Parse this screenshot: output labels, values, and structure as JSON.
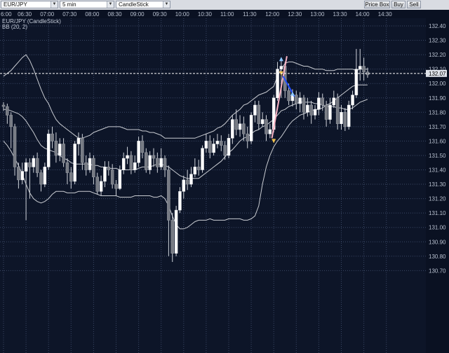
{
  "toolbar": {
    "symbol": "EUR/JPY",
    "timeframe": "5 min",
    "chart_style": "CandleStick",
    "buttons": [
      "Price Box",
      "Buy",
      "Sell"
    ]
  },
  "colors": {
    "background": "#0d1528",
    "grid": "#3a4764",
    "candle_up": "#ffffff",
    "candle_down": "#777b84",
    "wick": "#cfd3da",
    "bands": "#c9ccd2",
    "price_line": "#ffffff",
    "price_label_bg": "#dfe3ea",
    "marker_up": "#8fc8ff",
    "marker_down": "#f2c24d",
    "trend_pink": "#f7b3c4",
    "trend_blue": "#1f4dff"
  },
  "chart_data": {
    "type": "candlestick",
    "legend": [
      "EUR/JPY (CandleStick)",
      "BB (20, 2)"
    ],
    "x_ticks": [
      "6:00",
      "06:30",
      "07:00",
      "07:30",
      "08:00",
      "08:30",
      "09:00",
      "09:30",
      "10:00",
      "10:30",
      "11:00",
      "11:30",
      "12:00",
      "12:30",
      "13:00",
      "13:30",
      "14:00",
      "14:30"
    ],
    "y_ticks": [
      "132.40",
      "132.30",
      "132.20",
      "132.10",
      "132.00",
      "131.90",
      "131.80",
      "131.70",
      "131.60",
      "131.50",
      "131.40",
      "131.30",
      "131.20",
      "131.10",
      "131.00",
      "130.90",
      "130.80",
      "130.70"
    ],
    "ylim": [
      130.65,
      132.45
    ],
    "start_time": "06:00",
    "interval_minutes": 5,
    "current_price": "132.07",
    "candles": [
      [
        131.85,
        131.84,
        131.87,
        131.81
      ],
      [
        131.84,
        131.78,
        131.86,
        131.72
      ],
      [
        131.78,
        131.7,
        131.8,
        131.55
      ],
      [
        131.7,
        131.42,
        131.72,
        131.36
      ],
      [
        131.42,
        131.33,
        131.45,
        131.27
      ],
      [
        131.33,
        131.39,
        131.45,
        131.3
      ],
      [
        131.39,
        131.45,
        131.48,
        131.05
      ],
      [
        131.45,
        131.42,
        131.48,
        131.2
      ],
      [
        131.42,
        131.48,
        131.5,
        131.38
      ],
      [
        131.48,
        131.38,
        131.52,
        131.35
      ],
      [
        131.38,
        131.3,
        131.4,
        131.25
      ],
      [
        131.3,
        131.42,
        131.45,
        131.28
      ],
      [
        131.42,
        131.65,
        131.68,
        131.4
      ],
      [
        131.65,
        131.6,
        131.7,
        131.55
      ],
      [
        131.6,
        131.5,
        131.66,
        131.45
      ],
      [
        131.5,
        131.58,
        131.62,
        131.46
      ],
      [
        131.58,
        131.45,
        131.62,
        131.42
      ],
      [
        131.45,
        131.38,
        131.48,
        131.3
      ],
      [
        131.38,
        131.32,
        131.42,
        131.27
      ],
      [
        131.32,
        131.58,
        131.6,
        131.3
      ],
      [
        131.58,
        131.62,
        131.66,
        131.5
      ],
      [
        131.62,
        131.45,
        131.65,
        131.4
      ],
      [
        131.45,
        131.4,
        131.5,
        131.36
      ],
      [
        131.4,
        131.48,
        131.52,
        131.38
      ],
      [
        131.48,
        131.35,
        131.5,
        131.3
      ],
      [
        131.35,
        131.25,
        131.38,
        131.23
      ],
      [
        131.25,
        131.32,
        131.36,
        131.22
      ],
      [
        131.32,
        131.42,
        131.46,
        131.28
      ],
      [
        131.42,
        131.4,
        131.46,
        131.36
      ],
      [
        131.4,
        131.3,
        131.44,
        131.27
      ],
      [
        131.3,
        131.27,
        131.33,
        131.22
      ],
      [
        131.27,
        131.4,
        131.43,
        131.26
      ],
      [
        131.4,
        131.48,
        131.52,
        131.37
      ],
      [
        131.48,
        131.5,
        131.56,
        131.44
      ],
      [
        131.5,
        131.4,
        131.53,
        131.37
      ],
      [
        131.4,
        131.45,
        131.5,
        131.38
      ],
      [
        131.45,
        131.6,
        131.63,
        131.42
      ],
      [
        131.6,
        131.52,
        131.64,
        131.48
      ],
      [
        131.52,
        131.4,
        131.55,
        131.38
      ],
      [
        131.4,
        131.5,
        131.53,
        131.37
      ],
      [
        131.5,
        131.48,
        131.55,
        131.42
      ],
      [
        131.48,
        131.42,
        131.52,
        131.38
      ],
      [
        131.42,
        131.48,
        131.55,
        131.4
      ],
      [
        131.48,
        131.4,
        131.5,
        131.35
      ],
      [
        131.4,
        131.05,
        131.43,
        130.8
      ],
      [
        131.05,
        130.82,
        131.1,
        130.76
      ],
      [
        130.82,
        131.12,
        131.15,
        130.8
      ],
      [
        131.12,
        131.25,
        131.28,
        131.1
      ],
      [
        131.25,
        131.33,
        131.36,
        131.2
      ],
      [
        131.33,
        131.3,
        131.4,
        131.26
      ],
      [
        131.3,
        131.37,
        131.42,
        131.28
      ],
      [
        131.37,
        131.42,
        131.48,
        131.35
      ],
      [
        131.42,
        131.4,
        131.47,
        131.36
      ],
      [
        131.4,
        131.55,
        131.57,
        131.38
      ],
      [
        131.55,
        131.6,
        131.65,
        131.52
      ],
      [
        131.6,
        131.52,
        131.64,
        131.48
      ],
      [
        131.52,
        131.58,
        131.62,
        131.5
      ],
      [
        131.58,
        131.6,
        131.65,
        131.55
      ],
      [
        131.6,
        131.57,
        131.64,
        131.53
      ],
      [
        131.57,
        131.5,
        131.6,
        131.47
      ],
      [
        131.5,
        131.62,
        131.65,
        131.48
      ],
      [
        131.62,
        131.75,
        131.78,
        131.58
      ],
      [
        131.75,
        131.68,
        131.82,
        131.64
      ],
      [
        131.68,
        131.72,
        131.78,
        131.63
      ],
      [
        131.72,
        131.65,
        131.77,
        131.6
      ],
      [
        131.65,
        131.6,
        131.7,
        131.55
      ],
      [
        131.6,
        131.78,
        131.8,
        131.58
      ],
      [
        131.78,
        131.85,
        131.88,
        131.73
      ],
      [
        131.85,
        131.72,
        131.88,
        131.68
      ],
      [
        131.72,
        131.75,
        131.8,
        131.7
      ],
      [
        131.75,
        131.65,
        131.78,
        131.6
      ],
      [
        131.65,
        131.68,
        131.72,
        131.62
      ],
      [
        131.68,
        131.9,
        131.92,
        131.66
      ],
      [
        131.9,
        132.1,
        132.15,
        131.88
      ],
      [
        132.1,
        132.12,
        132.17,
        131.9
      ],
      [
        132.12,
        131.95,
        132.15,
        131.9
      ],
      [
        131.95,
        131.88,
        132.0,
        131.85
      ],
      [
        131.88,
        131.92,
        131.96,
        131.84
      ],
      [
        131.92,
        131.86,
        131.95,
        131.82
      ],
      [
        131.86,
        131.9,
        131.94,
        131.8
      ],
      [
        131.9,
        131.8,
        131.92,
        131.75
      ],
      [
        131.8,
        131.85,
        131.9,
        131.77
      ],
      [
        131.85,
        131.78,
        131.88,
        131.72
      ],
      [
        131.78,
        131.82,
        131.85,
        131.75
      ],
      [
        131.82,
        131.9,
        131.94,
        131.78
      ],
      [
        131.9,
        131.85,
        131.93,
        131.81
      ],
      [
        131.85,
        131.75,
        131.88,
        131.7
      ],
      [
        131.75,
        131.85,
        131.9,
        131.72
      ],
      [
        131.85,
        131.9,
        131.95,
        131.83
      ],
      [
        131.9,
        131.72,
        131.93,
        131.68
      ],
      [
        131.72,
        131.8,
        131.85,
        131.68
      ],
      [
        131.8,
        131.7,
        131.83,
        131.67
      ],
      [
        131.7,
        131.85,
        131.88,
        131.68
      ],
      [
        131.85,
        131.92,
        131.95,
        131.82
      ],
      [
        131.92,
        132.1,
        132.24,
        131.9
      ],
      [
        132.1,
        132.12,
        132.24,
        132.02
      ],
      [
        132.12,
        132.08,
        132.18,
        132.02
      ],
      [
        132.08,
        132.06,
        132.11,
        132.04
      ]
    ],
    "bollinger": {
      "upper": [
        132.05,
        132.07,
        132.09,
        132.12,
        132.15,
        132.18,
        132.2,
        132.16,
        132.1,
        132.03,
        131.96,
        131.9,
        131.86,
        131.8,
        131.75,
        131.72,
        131.7,
        131.68,
        131.66,
        131.64,
        131.62,
        131.62,
        131.63,
        131.64,
        131.66,
        131.67,
        131.68,
        131.69,
        131.7,
        131.7,
        131.7,
        131.7,
        131.69,
        131.68,
        131.68,
        131.68,
        131.68,
        131.67,
        131.67,
        131.66,
        131.66,
        131.65,
        131.64,
        131.62,
        131.62,
        131.62,
        131.62,
        131.62,
        131.62,
        131.62,
        131.62,
        131.62,
        131.63,
        131.64,
        131.65,
        131.66,
        131.67,
        131.69,
        131.7,
        131.72,
        131.75,
        131.78,
        131.8,
        131.82,
        131.85,
        131.86,
        131.88,
        131.9,
        131.92,
        131.93,
        131.94,
        131.96,
        131.98,
        132.05,
        132.1,
        132.14,
        132.15,
        132.15,
        132.14,
        132.13,
        132.12,
        132.12,
        132.11,
        132.1,
        132.1,
        132.1,
        132.09,
        132.09,
        132.09,
        132.1,
        132.1,
        132.1,
        132.1,
        132.1,
        132.09,
        132.1,
        132.1,
        132.1
      ],
      "middle": [
        131.82,
        131.82,
        131.81,
        131.8,
        131.79,
        131.77,
        131.74,
        131.7,
        131.66,
        131.61,
        131.57,
        131.55,
        131.54,
        131.53,
        131.52,
        131.5,
        131.48,
        131.47,
        131.45,
        131.44,
        131.44,
        131.44,
        131.44,
        131.44,
        131.43,
        131.43,
        131.42,
        131.42,
        131.41,
        131.41,
        131.41,
        131.4,
        131.4,
        131.4,
        131.4,
        131.4,
        131.41,
        131.42,
        131.42,
        131.42,
        131.43,
        131.44,
        131.44,
        131.43,
        131.42,
        131.4,
        131.38,
        131.36,
        131.35,
        131.34,
        131.34,
        131.34,
        131.34,
        131.36,
        131.38,
        131.4,
        131.42,
        131.44,
        131.46,
        131.49,
        131.52,
        131.54,
        131.57,
        131.6,
        131.62,
        131.63,
        131.65,
        131.67,
        131.68,
        131.7,
        131.71,
        131.73,
        131.75,
        131.78,
        131.81,
        131.82,
        131.84,
        131.85,
        131.86,
        131.87,
        131.87,
        131.87,
        131.87,
        131.86,
        131.86,
        131.85,
        131.84,
        131.84,
        131.84,
        131.83,
        131.83,
        131.82,
        131.82,
        131.83,
        131.85,
        131.87,
        131.88,
        131.89
      ],
      "lower": [
        131.6,
        131.57,
        131.53,
        131.48,
        131.43,
        131.37,
        131.3,
        131.24,
        131.2,
        131.18,
        131.17,
        131.18,
        131.2,
        131.23,
        131.25,
        131.25,
        131.25,
        131.24,
        131.24,
        131.24,
        131.25,
        131.25,
        131.25,
        131.25,
        131.24,
        131.23,
        131.22,
        131.22,
        131.22,
        131.22,
        131.22,
        131.21,
        131.21,
        131.21,
        131.21,
        131.22,
        131.22,
        131.22,
        131.22,
        131.22,
        131.21,
        131.21,
        131.22,
        131.2,
        131.15,
        131.08,
        131.02,
        130.99,
        130.99,
        131.0,
        131.02,
        131.04,
        131.05,
        131.05,
        131.05,
        131.06,
        131.05,
        131.05,
        131.05,
        131.05,
        131.06,
        131.06,
        131.06,
        131.06,
        131.05,
        131.05,
        131.06,
        131.08,
        131.15,
        131.3,
        131.42,
        131.5,
        131.56,
        131.6,
        131.63,
        131.67,
        131.71,
        131.74,
        131.76,
        131.78,
        131.79,
        131.8,
        131.81,
        131.82,
        131.82,
        131.83,
        131.85,
        131.86,
        131.88,
        131.9,
        131.92,
        131.94,
        131.96,
        131.98,
        131.99,
        131.99,
        131.99,
        131.99
      ]
    },
    "markers": [
      {
        "index": 72,
        "price": 131.6,
        "dir": "down"
      },
      {
        "index": 74,
        "price": 132.17,
        "dir": "up"
      },
      {
        "index": 74,
        "price": 132.07,
        "dir": "down"
      },
      {
        "index": 77,
        "price": 131.93,
        "dir": "up"
      }
    ],
    "trend_lines": [
      {
        "color": "trend_pink",
        "from": [
          71.5,
          131.62
        ],
        "to": [
          75.5,
          132.19
        ]
      },
      {
        "color": "trend_blue",
        "from": [
          74.5,
          132.05
        ],
        "to": [
          77.5,
          131.91
        ]
      }
    ]
  }
}
